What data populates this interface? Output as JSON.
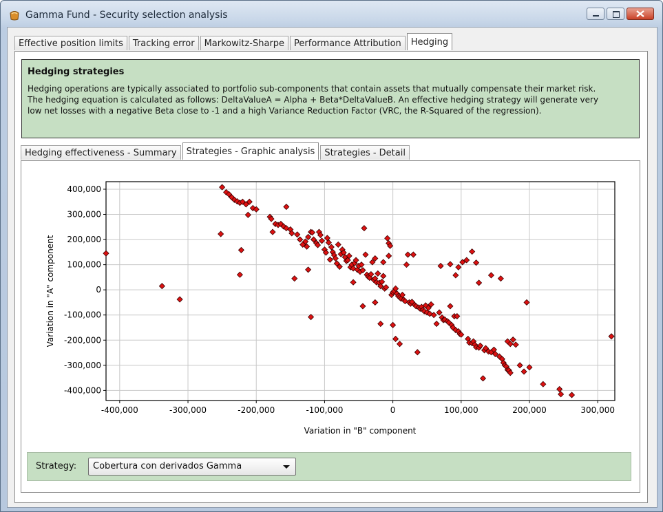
{
  "window": {
    "title": "Gamma Fund - Security selection analysis"
  },
  "main_tabs": [
    {
      "label": "Effective position limits",
      "active": false
    },
    {
      "label": "Tracking error",
      "active": false
    },
    {
      "label": "Markowitz-Sharpe",
      "active": false
    },
    {
      "label": "Performance Attribution",
      "active": false
    },
    {
      "label": "Hedging",
      "active": true
    }
  ],
  "info": {
    "title": "Hedging strategies",
    "body": "Hedging operations are typically associated to portfolio sub-components that contain assets that mutually compensate their market risk.\nThe hedging equation is calculated as follows: DeltaValueA = Alpha + Beta*DeltaValueB. An effective hedging strategy will generate very\nlow net losses with a negative Beta close to -1 and a high Variance Reduction Factor (VRC, the R-Squared of the regression)."
  },
  "sub_tabs": [
    {
      "label": "Hedging effectiveness - Summary",
      "active": false
    },
    {
      "label": "Strategies - Graphic analysis",
      "active": true
    },
    {
      "label": "Strategies - Detail",
      "active": false
    }
  ],
  "strategy": {
    "label": "Strategy:",
    "selected": "Cobertura con derivados Gamma"
  },
  "colors": {
    "marker_fill": "#dd1111",
    "info_bg": "#c6dfc3"
  },
  "chart_data": {
    "type": "scatter",
    "xlabel": "Variation in \"B\" component",
    "ylabel": "Variation in \"A\" component",
    "xlim": [
      -420000,
      325000
    ],
    "ylim": [
      -440000,
      430000
    ],
    "xticks": [
      -400000,
      -300000,
      -200000,
      -100000,
      0,
      100000,
      200000,
      300000
    ],
    "xtick_labels": [
      "-400,000",
      "-300,000",
      "-200,000",
      "-100,000",
      "0",
      "100,000",
      "200,000",
      "300,000"
    ],
    "yticks": [
      400000,
      300000,
      200000,
      100000,
      0,
      -100000,
      -200000,
      -300000,
      -400000
    ],
    "ytick_labels": [
      "400,000",
      "300,000",
      "200,000",
      "100,000",
      "0",
      "-100,000",
      "-200,000",
      "-300,000",
      "-400,000"
    ],
    "grid": true,
    "points": [
      [
        -420000,
        145000
      ],
      [
        -338000,
        15000
      ],
      [
        -312000,
        -38000
      ],
      [
        -250000,
        408000
      ],
      [
        -244000,
        388000
      ],
      [
        -240000,
        380000
      ],
      [
        -236000,
        368000
      ],
      [
        -232000,
        358000
      ],
      [
        -228000,
        352000
      ],
      [
        -224000,
        346000
      ],
      [
        -220000,
        350000
      ],
      [
        -215000,
        340000
      ],
      [
        -210000,
        350000
      ],
      [
        -205000,
        325000
      ],
      [
        -200000,
        320000
      ],
      [
        -212000,
        298000
      ],
      [
        -252000,
        222000
      ],
      [
        -222000,
        158000
      ],
      [
        -224000,
        60000
      ],
      [
        -180000,
        290000
      ],
      [
        -178000,
        282000
      ],
      [
        -172000,
        262000
      ],
      [
        -168000,
        258000
      ],
      [
        -164000,
        262000
      ],
      [
        -160000,
        252000
      ],
      [
        -156000,
        245000
      ],
      [
        -150000,
        240000
      ],
      [
        -148000,
        225000
      ],
      [
        -156000,
        330000
      ],
      [
        -176000,
        230000
      ],
      [
        -144000,
        45000
      ],
      [
        -140000,
        220000
      ],
      [
        -136000,
        200000
      ],
      [
        -132000,
        180000
      ],
      [
        -128000,
        192000
      ],
      [
        -126000,
        172000
      ],
      [
        -124000,
        210000
      ],
      [
        -120000,
        230000
      ],
      [
        -118000,
        228000
      ],
      [
        -116000,
        200000
      ],
      [
        -112000,
        186000
      ],
      [
        -110000,
        178000
      ],
      [
        -108000,
        230000
      ],
      [
        -106000,
        218000
      ],
      [
        -104000,
        195000
      ],
      [
        -100000,
        160000
      ],
      [
        -98000,
        148000
      ],
      [
        -96000,
        206000
      ],
      [
        -94000,
        188000
      ],
      [
        -92000,
        120000
      ],
      [
        -90000,
        170000
      ],
      [
        -88000,
        150000
      ],
      [
        -86000,
        138000
      ],
      [
        -84000,
        125000
      ],
      [
        -82000,
        105000
      ],
      [
        -80000,
        180000
      ],
      [
        -78000,
        92000
      ],
      [
        -76000,
        142000
      ],
      [
        -74000,
        160000
      ],
      [
        -72000,
        148000
      ],
      [
        -70000,
        130000
      ],
      [
        -68000,
        115000
      ],
      [
        -66000,
        118000
      ],
      [
        -64000,
        135000
      ],
      [
        -62000,
        90000
      ],
      [
        -60000,
        100000
      ],
      [
        -58000,
        85000
      ],
      [
        -56000,
        106000
      ],
      [
        -54000,
        118000
      ],
      [
        -52000,
        80000
      ],
      [
        -50000,
        95000
      ],
      [
        -48000,
        72000
      ],
      [
        -46000,
        100000
      ],
      [
        -44000,
        78000
      ],
      [
        -42000,
        245000
      ],
      [
        -40000,
        140000
      ],
      [
        -38000,
        60000
      ],
      [
        -36000,
        52000
      ],
      [
        -34000,
        48000
      ],
      [
        -32000,
        62000
      ],
      [
        -30000,
        110000
      ],
      [
        -28000,
        40000
      ],
      [
        -26000,
        45000
      ],
      [
        -24000,
        30000
      ],
      [
        -22000,
        65000
      ],
      [
        -20000,
        28000
      ],
      [
        -18000,
        15000
      ],
      [
        -16000,
        32000
      ],
      [
        -14000,
        55000
      ],
      [
        -12000,
        5000
      ],
      [
        -10000,
        10000
      ],
      [
        -8000,
        205000
      ],
      [
        -6000,
        185000
      ],
      [
        -4000,
        175000
      ],
      [
        -2000,
        -20000
      ],
      [
        0,
        -10000
      ],
      [
        2000,
        -5000
      ],
      [
        4000,
        5000
      ],
      [
        6000,
        -15000
      ],
      [
        8000,
        -25000
      ],
      [
        10000,
        -30000
      ],
      [
        12000,
        -35000
      ],
      [
        14000,
        -20000
      ],
      [
        16000,
        -40000
      ],
      [
        18000,
        -45000
      ],
      [
        20000,
        100000
      ],
      [
        22000,
        140000
      ],
      [
        24000,
        -50000
      ],
      [
        26000,
        -55000
      ],
      [
        28000,
        -48000
      ],
      [
        30000,
        140000
      ],
      [
        32000,
        -60000
      ],
      [
        34000,
        -65000
      ],
      [
        36000,
        -248000
      ],
      [
        38000,
        -70000
      ],
      [
        40000,
        -75000
      ],
      [
        42000,
        -68000
      ],
      [
        44000,
        -80000
      ],
      [
        46000,
        -85000
      ],
      [
        48000,
        -62000
      ],
      [
        50000,
        -90000
      ],
      [
        52000,
        -72000
      ],
      [
        54000,
        -95000
      ],
      [
        56000,
        -58000
      ],
      [
        -44000,
        -65000
      ],
      [
        -58000,
        30000
      ],
      [
        -26000,
        -50000
      ],
      [
        -18000,
        -135000
      ],
      [
        -26000,
        125000
      ],
      [
        -14000,
        110000
      ],
      [
        -6000,
        135000
      ],
      [
        0,
        -140000
      ],
      [
        4000,
        -195000
      ],
      [
        10000,
        -215000
      ],
      [
        -120000,
        -108000
      ],
      [
        -124000,
        80000
      ],
      [
        60000,
        -100000
      ],
      [
        64000,
        -135000
      ],
      [
        68000,
        -90000
      ],
      [
        70000,
        95000
      ],
      [
        72000,
        -110000
      ],
      [
        74000,
        -120000
      ],
      [
        76000,
        -118000
      ],
      [
        80000,
        -125000
      ],
      [
        82000,
        -130000
      ],
      [
        84000,
        -65000
      ],
      [
        86000,
        -140000
      ],
      [
        88000,
        -150000
      ],
      [
        90000,
        -105000
      ],
      [
        92000,
        -160000
      ],
      [
        94000,
        -105000
      ],
      [
        96000,
        -165000
      ],
      [
        98000,
        -175000
      ],
      [
        100000,
        -178000
      ],
      [
        84000,
        102000
      ],
      [
        92000,
        58000
      ],
      [
        96000,
        90000
      ],
      [
        102000,
        110000
      ],
      [
        108000,
        118000
      ],
      [
        110000,
        -195000
      ],
      [
        112000,
        -210000
      ],
      [
        116000,
        -212000
      ],
      [
        118000,
        -205000
      ],
      [
        120000,
        -218000
      ],
      [
        122000,
        -228000
      ],
      [
        126000,
        -230000
      ],
      [
        128000,
        -222000
      ],
      [
        132000,
        -352000
      ],
      [
        134000,
        -240000
      ],
      [
        136000,
        -232000
      ],
      [
        140000,
        -245000
      ],
      [
        144000,
        -248000
      ],
      [
        148000,
        -238000
      ],
      [
        150000,
        -255000
      ],
      [
        156000,
        -265000
      ],
      [
        160000,
        -275000
      ],
      [
        162000,
        -290000
      ],
      [
        164000,
        -300000
      ],
      [
        166000,
        -305000
      ],
      [
        168000,
        -318000
      ],
      [
        170000,
        -320000
      ],
      [
        172000,
        -330000
      ],
      [
        158000,
        45000
      ],
      [
        144000,
        58000
      ],
      [
        122000,
        108000
      ],
      [
        116000,
        152000
      ],
      [
        126000,
        28000
      ],
      [
        168000,
        -205000
      ],
      [
        172000,
        -215000
      ],
      [
        176000,
        -198000
      ],
      [
        180000,
        -218000
      ],
      [
        186000,
        -300000
      ],
      [
        192000,
        -325000
      ],
      [
        196000,
        -50000
      ],
      [
        200000,
        -308000
      ],
      [
        220000,
        -375000
      ],
      [
        244000,
        -395000
      ],
      [
        246000,
        -415000
      ],
      [
        262000,
        -418000
      ],
      [
        320000,
        -185000
      ]
    ]
  }
}
